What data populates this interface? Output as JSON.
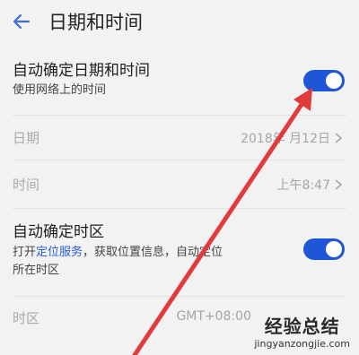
{
  "header": {
    "back_icon": "arrow-left-icon",
    "title": "日期和时间"
  },
  "auto_datetime": {
    "title": "自动确定日期和时间",
    "subtitle": "使用网络上的时间",
    "enabled": true
  },
  "date_row": {
    "label": "日期",
    "value": "2018年 月12日"
  },
  "time_row": {
    "label": "时间",
    "value": "上午8:47"
  },
  "auto_timezone": {
    "title": "自动确定时区",
    "subtitle_prefix": "打开",
    "subtitle_link": "定位服务",
    "subtitle_line1_rest": "，获取位置信息，自动定位",
    "subtitle_line2": "所在时区",
    "enabled": true
  },
  "timezone_row": {
    "label": "时区",
    "value": "GMT+08:00"
  },
  "watermark": {
    "main": "经验总结",
    "sub": "jingyanzongjie.com"
  },
  "colors": {
    "accent": "#1f56d8",
    "annotation_arrow": "#e23b3b"
  }
}
